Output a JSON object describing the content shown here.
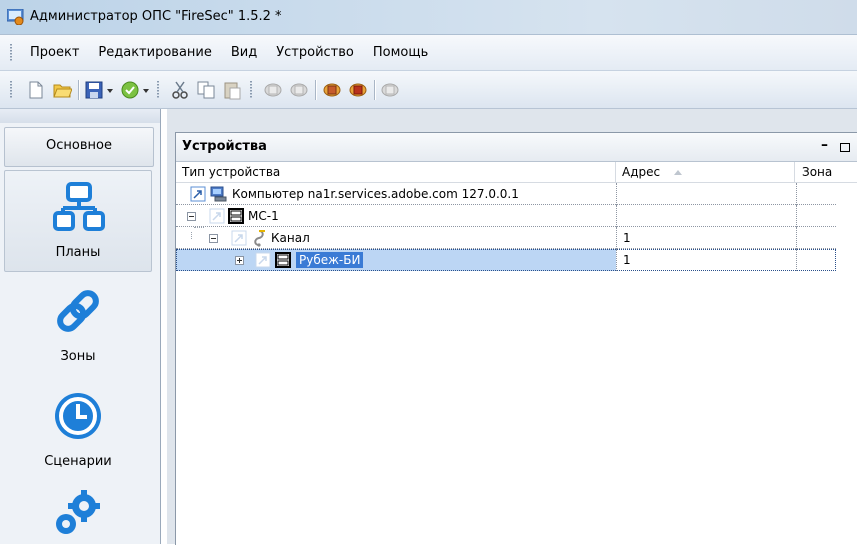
{
  "window": {
    "title": "Администратор ОПС \"FireSec\" 1.5.2 *",
    "app_icon": "firesec-app-icon"
  },
  "menu": {
    "items": [
      "Проект",
      "Редактирование",
      "Вид",
      "Устройство",
      "Помощь"
    ]
  },
  "toolbar": {
    "buttons": [
      "new-file-icon",
      "open-folder-icon",
      "save-icon",
      "dropdown-arrow-icon",
      "validate-check-icon",
      "dropdown-arrow-icon",
      "cut-icon",
      "copy-icon",
      "paste-icon",
      "device-read-icon",
      "device-write-icon",
      "device-connect-icon",
      "device-disconnect-icon",
      "device-status-icon"
    ]
  },
  "left_nav": {
    "header": "Основное",
    "items": [
      {
        "label": "Планы",
        "icon": "plans-network-icon",
        "selected": true
      },
      {
        "label": "Зоны",
        "icon": "zones-link-icon",
        "selected": false
      },
      {
        "label": "Сценарии",
        "icon": "scenarios-clock-icon",
        "selected": false
      },
      {
        "label": "",
        "icon": "settings-gears-icon",
        "selected": false
      }
    ]
  },
  "devices_panel": {
    "title": "Устройства",
    "columns": {
      "type": "Тип устройства",
      "address": "Адрес",
      "zone": "Зона"
    },
    "sort_column": "address",
    "rows": [
      {
        "name": "Компьютер na1r.services.adobe.com 127.0.0.1",
        "address": "",
        "zone": "",
        "level": 0,
        "icon": "computer-icon",
        "expander": "none",
        "selected": false
      },
      {
        "name": "МС-1",
        "address": "",
        "zone": "",
        "level": 0,
        "icon": "module-icon",
        "expander": "minus",
        "selected": false
      },
      {
        "name": "Канал",
        "address": "1",
        "zone": "",
        "level": 1,
        "icon": "channel-icon",
        "expander": "minus",
        "selected": false
      },
      {
        "name": "Рубеж-БИ",
        "address": "1",
        "zone": "",
        "level": 2,
        "icon": "module-icon",
        "expander": "plus",
        "selected": true
      }
    ]
  },
  "colors": {
    "selection": "#bcd6f4",
    "titlebar": "#c9dbec",
    "accent_blue": "#1e7fd8"
  }
}
